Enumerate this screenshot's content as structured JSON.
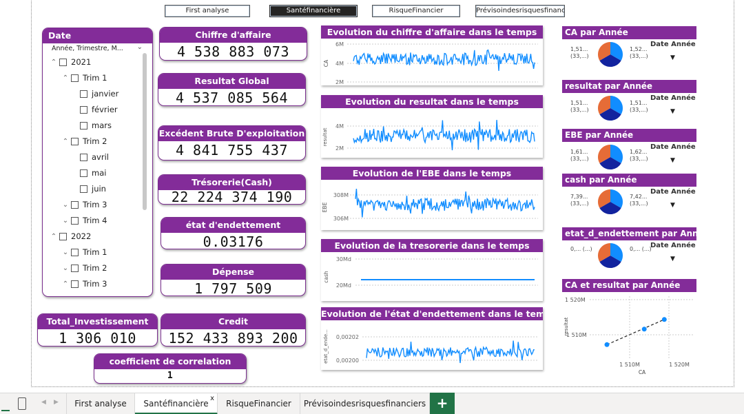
{
  "nav": {
    "buttons": [
      {
        "label": "First analyse"
      },
      {
        "label": "Santéfinancière"
      },
      {
        "label": "RisqueFinancier"
      },
      {
        "label": "Prévisoindesrisquesfinanc..."
      }
    ]
  },
  "slicer": {
    "title": "Date",
    "dropdown": "Année, Trimestre, M...",
    "items": [
      {
        "label": "2021",
        "twist": "^"
      },
      {
        "label": "Trim 1",
        "twist": "^"
      },
      {
        "label": "janvier",
        "twist": ""
      },
      {
        "label": "février",
        "twist": ""
      },
      {
        "label": "mars",
        "twist": ""
      },
      {
        "label": "Trim 2",
        "twist": "^"
      },
      {
        "label": "avril",
        "twist": ""
      },
      {
        "label": "mai",
        "twist": ""
      },
      {
        "label": "juin",
        "twist": ""
      },
      {
        "label": "Trim 3",
        "twist": "v"
      },
      {
        "label": "Trim 4",
        "twist": "v"
      },
      {
        "label": "2022",
        "twist": "^"
      },
      {
        "label": "Trim 1",
        "twist": "v"
      },
      {
        "label": "Trim 2",
        "twist": "v"
      },
      {
        "label": "Trim 3",
        "twist": "^"
      }
    ]
  },
  "kpis": {
    "chiffre": {
      "title": "Chiffre d'affaire",
      "value": "4 538 883 073"
    },
    "resultat": {
      "title": "Resultat Global",
      "value": "4 537 085 564"
    },
    "ebe": {
      "title": "Excédent Brute D'exploitation",
      "value": "4 841 755 437"
    },
    "tresorerie": {
      "title": "Trésorerie(Cash)",
      "value": "22 224 374 190"
    },
    "endettement": {
      "title": "état d'endettement",
      "value": "0.03176"
    },
    "depense": {
      "title": "Dépense",
      "value": "1 797 509"
    },
    "investissement": {
      "title": "Total_Investissement",
      "value": "1 306 010"
    },
    "credit": {
      "title": "Credit",
      "value": "152 433 893 200"
    },
    "correlation": {
      "title": "coefficient de correlation",
      "value": "1"
    }
  },
  "charts": {
    "ca": {
      "title": "Evolution du chiffre d'affaire dans le temps",
      "ylabel": "CA",
      "ticks": [
        "6M",
        "4M",
        "2M"
      ]
    },
    "resultat": {
      "title": "Evolution du resultat dans le temps",
      "ylabel": "resultat",
      "ticks": [
        "4M",
        "2M"
      ]
    },
    "ebe": {
      "title": "Evolution de l'EBE dans le temps",
      "ylabel": "EBE",
      "ticks": [
        "308M",
        "306M"
      ]
    },
    "tresorerie": {
      "title": "Evolution de la tresorerie dans le temps",
      "ylabel": "cash",
      "ticks": [
        "30Md",
        "20Md"
      ]
    },
    "endettement": {
      "title": "Evolution de l'état d'endettement dans le temps",
      "ylabel": "etat_d_ende...",
      "ticks": [
        "0,00202",
        "0,00200"
      ]
    }
  },
  "pies": [
    {
      "title": "CA par Année",
      "left": "1,51...",
      "left2": "(33,...)",
      "right": "1,52...",
      "right2": "(33,...)",
      "legend": "Date Année"
    },
    {
      "title": "resultat par Année",
      "left": "1,51...",
      "left2": "(33,...)",
      "right": "1,51...",
      "right2": "(33,...)",
      "legend": "Date Année"
    },
    {
      "title": "EBE par Année",
      "left": "1,61...",
      "left2": "(33,...)",
      "right": "1,62...",
      "right2": "(33,...)",
      "legend": "Date Année"
    },
    {
      "title": "cash par Année",
      "left": "7,39...",
      "left2": "(33,...)",
      "right": "7,42...",
      "right2": "(33,...)",
      "legend": "Date Année"
    },
    {
      "title": "etat_d_endettement par Année",
      "left": "0,... (...)",
      "left2": "",
      "right": "0,... (...)",
      "right2": "",
      "legend": "Date Année"
    }
  ],
  "colors": {
    "pie1": "#118dff",
    "pie2": "#12239e",
    "pie3": "#e66c37",
    "accent": "#832c99"
  },
  "scatter": {
    "title": "CA et resultat par Année",
    "xlabel": "CA",
    "ylabel": "resultat",
    "yticks": [
      "1 520M",
      "1 510M"
    ],
    "xticks": [
      "1 510M",
      "1 520M"
    ]
  },
  "chart_data": {
    "type": "scatter",
    "title": "CA et resultat par Année",
    "xlabel": "CA",
    "ylabel": "resultat",
    "xlim": [
      1504,
      1522
    ],
    "ylim": [
      1505,
      1521
    ],
    "x": [
      1507,
      1513.5,
      1517
    ],
    "y": [
      1508.5,
      1512.5,
      1515
    ]
  },
  "tabs": {
    "items": [
      {
        "label": "First analyse"
      },
      {
        "label": "Santéfinancière"
      },
      {
        "label": "RisqueFinancier"
      },
      {
        "label": "Prévisoindesrisquesfinanciers"
      }
    ],
    "close": "x",
    "add": "+"
  }
}
